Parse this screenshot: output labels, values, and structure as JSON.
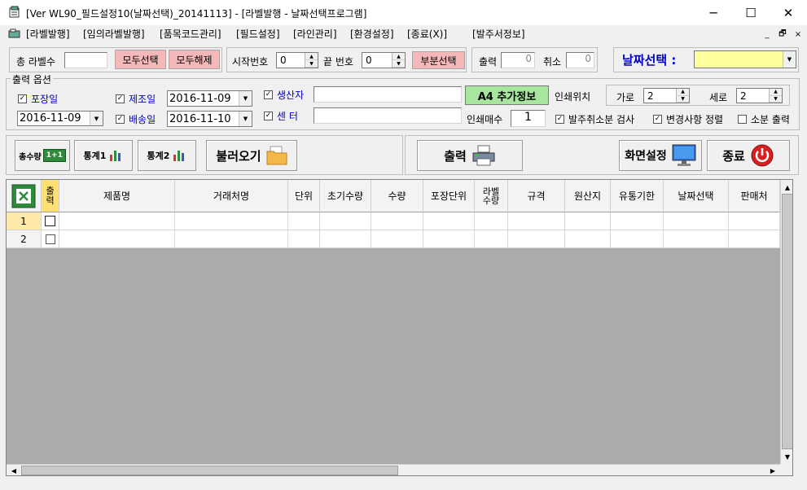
{
  "window": {
    "title": "[Ver WL90_필드설정10(날짜선택)_20141113] - [라벨발행 - 날짜선택프로그램]",
    "minimize": "─",
    "maximize": "☐",
    "close": "✕"
  },
  "menu": [
    "[라벨발행]",
    "[임의라벨발행]",
    "[품목코드관리]",
    "[필드설정]",
    "[라인관리]",
    "[환경설정]",
    "[종료(X)]",
    "[발주서정보]"
  ],
  "mdi": {
    "minimize": "_",
    "restore": "🗗",
    "close": "×"
  },
  "top": {
    "total_label": "총 라벨수",
    "total_value": "",
    "select_all": "모두선택",
    "deselect_all": "모두해제",
    "start_label": "시작번호",
    "start_value": "0",
    "end_label": "끝 번호",
    "end_value": "0",
    "partial": "부분선택",
    "print_label": "출력",
    "print_value": "0",
    "cancel_label": "취소",
    "cancel_value": "0",
    "date_select_label": "날짜선택 :",
    "date_select_value": ""
  },
  "options": {
    "legend": "출력 옵션",
    "pack_date": "포장일",
    "mfg_date": "제조일",
    "mfg_value": "2016-11-09",
    "pack_value": "2016-11-09",
    "ship_date": "배송일",
    "ship_value": "2016-11-10",
    "producer": "생산자",
    "center": "센 터",
    "a4_btn": "A4 추가정보",
    "print_pos": "인쇄위치",
    "horiz_label": "가로",
    "horiz_value": "2",
    "vert_label": "세로",
    "vert_value": "2",
    "copies_label": "인쇄매수",
    "copies_value": "1",
    "chk_cancel": "발주취소분 검사",
    "chk_sort": "변경사항 정렬",
    "chk_small": "소분 출력"
  },
  "toolbar": {
    "total_qty": "총수량",
    "total_qty_badge": "1+1",
    "stats1": "통계1",
    "stats2": "통계2",
    "load": "불러오기",
    "print": "출력",
    "screen": "화면설정",
    "exit": "종료"
  },
  "grid": {
    "columns": [
      "출력",
      "제품명",
      "거래처명",
      "단위",
      "초기수량",
      "수량",
      "포장단위",
      "라벨수량",
      "규격",
      "원산지",
      "유통기한",
      "날짜선택",
      "판매처"
    ],
    "rows": [
      "1",
      "2"
    ]
  },
  "colors": {
    "accent_blue": "#0000c8",
    "pink": "#f4b8b8",
    "yellow": "#ffffa0",
    "green": "#a8e6a0"
  }
}
